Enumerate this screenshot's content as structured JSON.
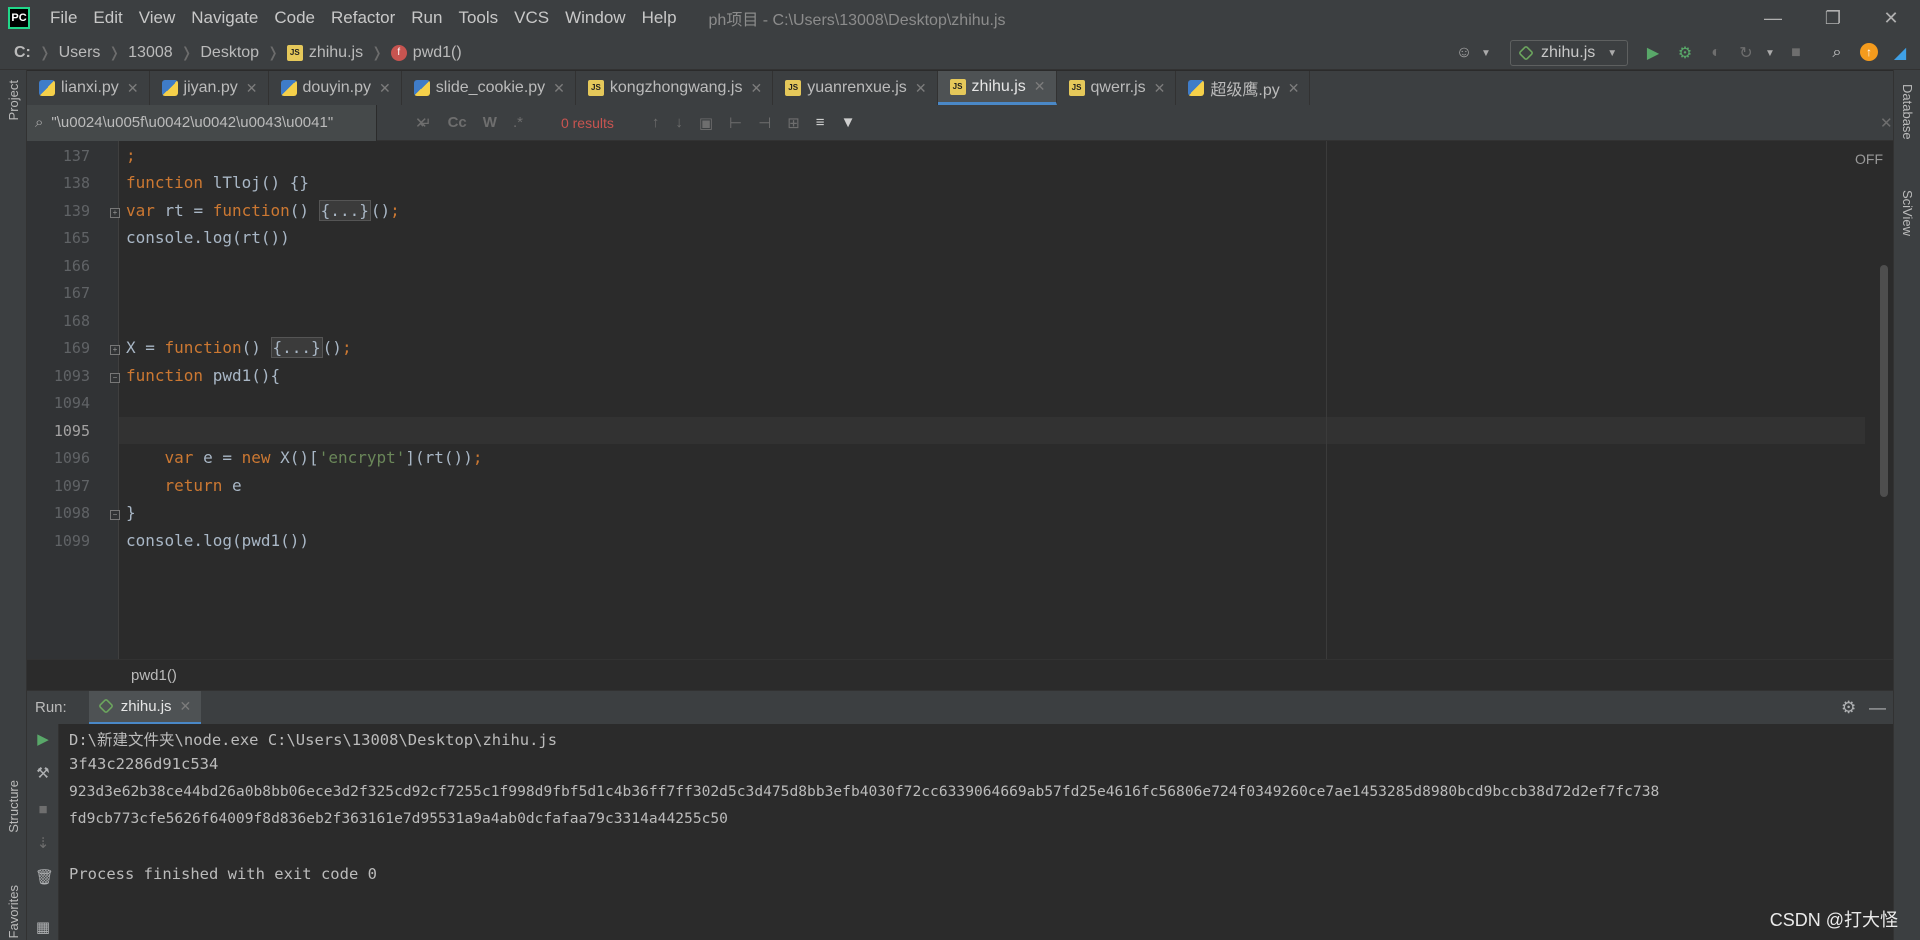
{
  "menubar": {
    "logo_text": "PC",
    "items": [
      "File",
      "Edit",
      "View",
      "Navigate",
      "Code",
      "Refactor",
      "Run",
      "Tools",
      "VCS",
      "Window",
      "Help"
    ],
    "window_title": "ph项目 - C:\\Users\\13008\\Desktop\\zhihu.js"
  },
  "navbar": {
    "crumbs": [
      "C:",
      "Users",
      "13008",
      "Desktop",
      "zhihu.js",
      "pwd1()"
    ],
    "run_config": "zhihu.js"
  },
  "tabs": [
    {
      "label": "lianxi.py",
      "type": "py",
      "active": false
    },
    {
      "label": "jiyan.py",
      "type": "py",
      "active": false
    },
    {
      "label": "douyin.py",
      "type": "py",
      "active": false
    },
    {
      "label": "slide_cookie.py",
      "type": "py",
      "active": false
    },
    {
      "label": "kongzhongwang.js",
      "type": "js",
      "active": false
    },
    {
      "label": "yuanrenxue.js",
      "type": "js",
      "active": false
    },
    {
      "label": "zhihu.js",
      "type": "js",
      "active": true
    },
    {
      "label": "qwerr.js",
      "type": "js",
      "active": false
    },
    {
      "label": "超级鹰.py",
      "type": "py",
      "active": false
    }
  ],
  "search": {
    "query": "\"\\u0024\\u005f\\u0042\\u0042\\u0043\\u0041\"",
    "results": "0 results"
  },
  "editor": {
    "line_numbers": [
      "137",
      "138",
      "139",
      "165",
      "166",
      "167",
      "168",
      "169",
      "1093",
      "1094",
      "1095",
      "1096",
      "1097",
      "1098",
      "1099"
    ],
    "off_label": "OFF",
    "footer_function": "pwd1()"
  },
  "side_tools": {
    "left": [
      "Project",
      "Structure",
      "Favorites"
    ],
    "right": [
      "Database",
      "SciView"
    ]
  },
  "run": {
    "label": "Run:",
    "tab_label": "zhihu.js",
    "output": [
      "D:\\新建文件夹\\node.exe C:\\Users\\13008\\Desktop\\zhihu.js",
      "3f43c2286d91c534",
      "923d3e62b38ce44bd26a0b8bb06ece3d2f325cd92cf7255c1f998d9fbf5d1c4b36ff7ff302d5c3d475d8bb3efb4030f72cc6339064669ab57fd25e4616fc56806e724f0349260ce7ae1453285d8980bcd9bccb38d72d2ef7fc738",
      "fd9cb773cfe5626f64009f8d836eb2f363161e7d95531a9a4ab0dcfafaa79c3314a44255c50",
      "",
      "Process finished with exit code 0"
    ]
  },
  "watermark": "CSDN @打大怪",
  "colors": {
    "keyword": "#cc7832",
    "string": "#6a8759",
    "accent": "#4a88c7",
    "error": "#c75450"
  }
}
